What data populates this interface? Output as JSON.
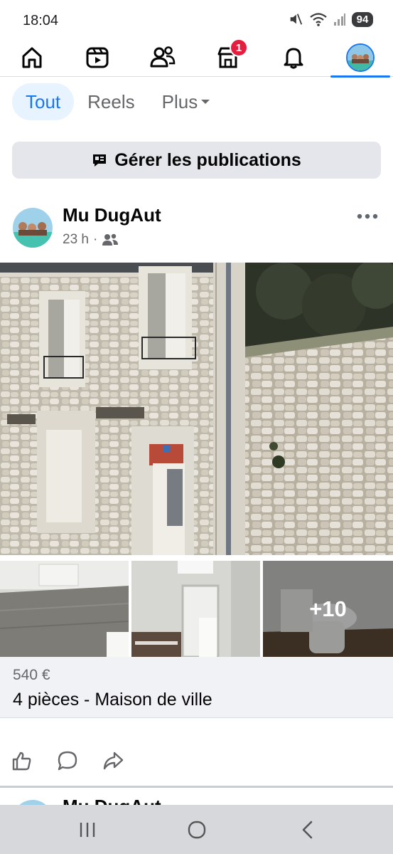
{
  "status_bar": {
    "time": "18:04",
    "battery": "94",
    "icons": [
      "mute-icon",
      "wifi-icon",
      "signal-icon",
      "battery-icon"
    ]
  },
  "top_nav": {
    "items": [
      {
        "name": "home",
        "icon": "home-icon"
      },
      {
        "name": "reels",
        "icon": "video-icon"
      },
      {
        "name": "friends",
        "icon": "people-icon"
      },
      {
        "name": "marketplace",
        "icon": "shop-icon",
        "badge": "1"
      },
      {
        "name": "notifications",
        "icon": "bell-icon"
      },
      {
        "name": "profile",
        "icon": "avatar-icon"
      }
    ],
    "active": "profile"
  },
  "filters": {
    "tabs": [
      {
        "label": "Tout",
        "active": true
      },
      {
        "label": "Reels",
        "active": false
      },
      {
        "label": "Plus",
        "active": false
      }
    ]
  },
  "manage": {
    "label": "Gérer les publications"
  },
  "post": {
    "author": "Mu DugAut",
    "time": "23 h",
    "separator": "·",
    "audience_icon": "friends-icon",
    "more_icon": "more-horizontal-icon",
    "photos_more_label": "+10",
    "listing": {
      "price": "540 €",
      "title": "4 pièces - Maison de ville"
    },
    "actions": [
      {
        "name": "like",
        "icon": "thumbs-up-icon"
      },
      {
        "name": "comment",
        "icon": "comment-icon"
      },
      {
        "name": "share",
        "icon": "share-icon"
      }
    ]
  },
  "next_post": {
    "author": "Mu DugAut"
  },
  "colors": {
    "accent": "#1877f2",
    "badge": "#e41e3f",
    "chip_active_bg": "#e7f3ff",
    "button_bg": "#e4e6eb",
    "listing_bg": "#f0f2f5"
  }
}
